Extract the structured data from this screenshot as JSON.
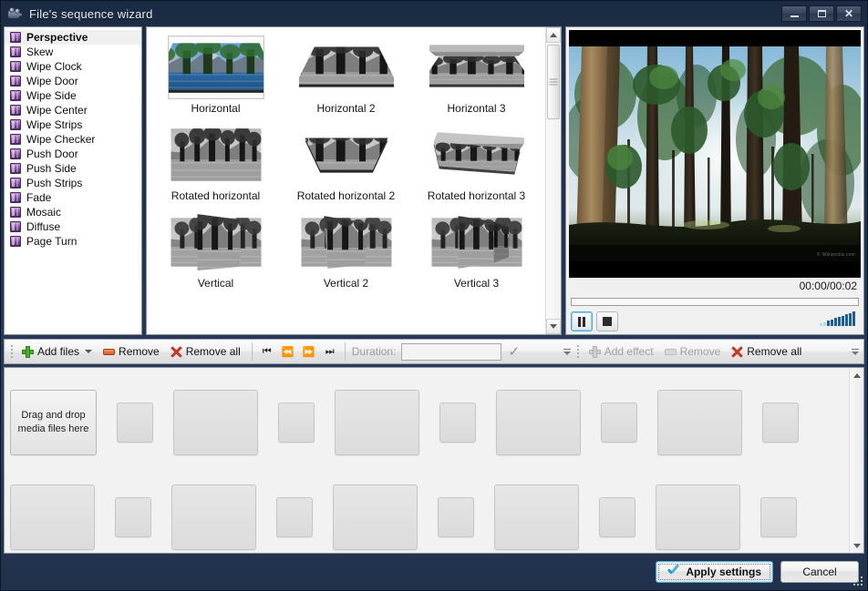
{
  "window": {
    "title": "File's sequence wizard",
    "icon": "film-camera-icon",
    "minimize_label": "Minimize",
    "maximize_label": "Maximize",
    "close_label": "Close"
  },
  "effects_list": {
    "items": [
      {
        "label": "Perspective",
        "selected": true
      },
      {
        "label": "Skew",
        "selected": false
      },
      {
        "label": "Wipe Clock",
        "selected": false
      },
      {
        "label": "Wipe Door",
        "selected": false
      },
      {
        "label": "Wipe Side",
        "selected": false
      },
      {
        "label": "Wipe Center",
        "selected": false
      },
      {
        "label": "Wipe Strips",
        "selected": false
      },
      {
        "label": "Wipe Checker",
        "selected": false
      },
      {
        "label": "Push Door",
        "selected": false
      },
      {
        "label": "Push Side",
        "selected": false
      },
      {
        "label": "Push Strips",
        "selected": false
      },
      {
        "label": "Fade",
        "selected": false
      },
      {
        "label": "Mosaic",
        "selected": false
      },
      {
        "label": "Diffuse",
        "selected": false
      },
      {
        "label": "Page Turn",
        "selected": false
      }
    ]
  },
  "variants": {
    "items": [
      {
        "label": "Horizontal",
        "selected": true,
        "style": "horizontal"
      },
      {
        "label": "Horizontal 2",
        "selected": false,
        "style": "horizontal2"
      },
      {
        "label": "Horizontal 3",
        "selected": false,
        "style": "horizontal3"
      },
      {
        "label": "Rotated horizontal",
        "selected": false,
        "style": "rot1"
      },
      {
        "label": "Rotated horizontal 2",
        "selected": false,
        "style": "rot2"
      },
      {
        "label": "Rotated horizontal 3",
        "selected": false,
        "style": "rot3"
      },
      {
        "label": "Vertical",
        "selected": false,
        "style": "vert1"
      },
      {
        "label": "Vertical 2",
        "selected": false,
        "style": "vert2"
      },
      {
        "label": "Vertical 3",
        "selected": false,
        "style": "vert3"
      }
    ]
  },
  "preview": {
    "time_display": "00:00/00:02",
    "current_time": "00:00",
    "total_time": "00:02",
    "seek_percent": 0,
    "pause_label": "Pause",
    "stop_label": "Stop",
    "volume_percent": 100,
    "watermark": "© Wikipedia.com"
  },
  "toolbar_left": {
    "add_files": "Add files",
    "remove": "Remove",
    "remove_all": "Remove all",
    "nav_first": "⏮",
    "nav_prev": "⏪",
    "nav_next": "⏩",
    "nav_last": "⏭",
    "duration_label": "Duration:",
    "duration_value": "",
    "duration_placeholder": ""
  },
  "toolbar_right": {
    "add_effect": "Add effect",
    "remove": "Remove",
    "remove_all": "Remove all"
  },
  "storyboard": {
    "dropzone_text": "Drag and drop media files here",
    "rows": [
      {
        "slots": [
          "dropzone",
          "small",
          "big",
          "small",
          "big",
          "small",
          "big",
          "small",
          "big",
          "small"
        ]
      },
      {
        "slots": [
          "big",
          "small",
          "big",
          "small",
          "big",
          "small",
          "big",
          "small",
          "big",
          "small"
        ]
      }
    ]
  },
  "footer": {
    "apply_label": "Apply settings",
    "cancel_label": "Cancel"
  },
  "colors": {
    "accent": "#2f93c9",
    "titlebar": "#22334f",
    "selection": "#f0f0f0"
  }
}
